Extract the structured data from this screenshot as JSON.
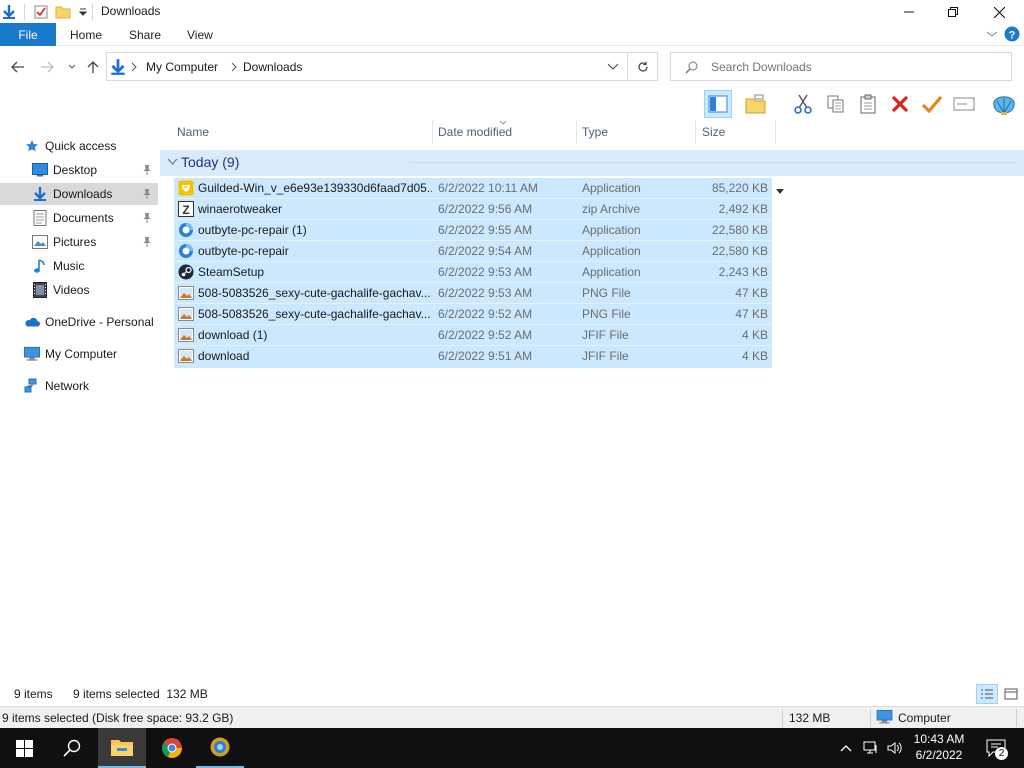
{
  "window": {
    "title": "Downloads",
    "ribbon_tabs": [
      "File",
      "Home",
      "Share",
      "View"
    ]
  },
  "address": {
    "breadcrumb": [
      "My Computer",
      "Downloads"
    ],
    "search_placeholder": "Search Downloads"
  },
  "nav": {
    "items": [
      {
        "label": "Quick access",
        "icon": "star-icon"
      },
      {
        "label": "Desktop",
        "icon": "desktop-icon",
        "pinned": true
      },
      {
        "label": "Downloads",
        "icon": "download-icon",
        "pinned": true,
        "selected": true
      },
      {
        "label": "Documents",
        "icon": "document-icon",
        "pinned": true
      },
      {
        "label": "Pictures",
        "icon": "pictures-icon",
        "pinned": true
      },
      {
        "label": "Music",
        "icon": "music-icon"
      },
      {
        "label": "Videos",
        "icon": "videos-icon"
      },
      {
        "label": "OneDrive - Personal",
        "icon": "cloud-icon"
      },
      {
        "label": "My Computer",
        "icon": "computer-icon"
      },
      {
        "label": "Network",
        "icon": "network-icon"
      }
    ]
  },
  "columns": [
    "Name",
    "Date modified",
    "Type",
    "Size"
  ],
  "group": {
    "label": "Today (9)"
  },
  "files": [
    {
      "name": "Guilded-Win_v_e6e93e139330d6faad7d05...",
      "date": "6/2/2022 10:11 AM",
      "type": "Application",
      "size": "85,220 KB",
      "icon": "guilded-app-icon"
    },
    {
      "name": "winaerotweaker",
      "date": "6/2/2022 9:56 AM",
      "type": "zip Archive",
      "size": "2,492 KB",
      "icon": "zip-archive-icon"
    },
    {
      "name": "outbyte-pc-repair (1)",
      "date": "6/2/2022 9:55 AM",
      "type": "Application",
      "size": "22,580 KB",
      "icon": "outbyte-app-icon"
    },
    {
      "name": "outbyte-pc-repair",
      "date": "6/2/2022 9:54 AM",
      "type": "Application",
      "size": "22,580 KB",
      "icon": "outbyte-app-icon"
    },
    {
      "name": "SteamSetup",
      "date": "6/2/2022 9:53 AM",
      "type": "Application",
      "size": "2,243 KB",
      "icon": "steam-app-icon"
    },
    {
      "name": "508-5083526_sexy-cute-gachalife-gachav...",
      "date": "6/2/2022 9:53 AM",
      "type": "PNG File",
      "size": "47 KB",
      "icon": "image-file-icon"
    },
    {
      "name": "508-5083526_sexy-cute-gachalife-gachav...",
      "date": "6/2/2022 9:52 AM",
      "type": "PNG File",
      "size": "47 KB",
      "icon": "image-file-icon"
    },
    {
      "name": "download (1)",
      "date": "6/2/2022 9:52 AM",
      "type": "JFIF File",
      "size": "4 KB",
      "icon": "image-file-icon"
    },
    {
      "name": "download",
      "date": "6/2/2022 9:51 AM",
      "type": "JFIF File",
      "size": "4 KB",
      "icon": "image-file-icon"
    }
  ],
  "status": {
    "items_count": "9 items",
    "selected": "9 items selected  132 MB",
    "bottom_left": "9 items selected (Disk free space: 93.2 GB)",
    "bottom_size": "132 MB",
    "bottom_location": "Computer"
  },
  "taskbar": {
    "time": "10:43 AM",
    "date": "6/2/2022",
    "notification_count": "2"
  },
  "colors": {
    "accent": "#1979ca",
    "selection": "#cce8ff",
    "group_bg": "#d9ebf9",
    "group_text": "#1e3287"
  }
}
